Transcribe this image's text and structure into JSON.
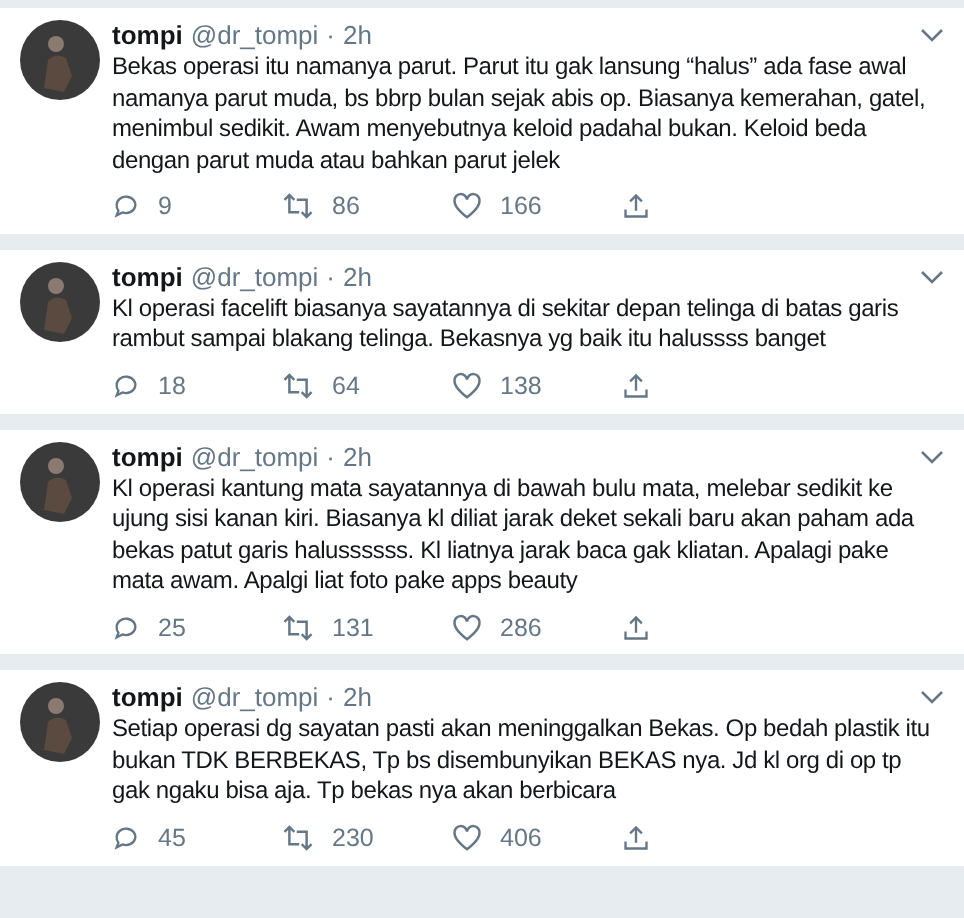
{
  "tweets": [
    {
      "name": "tompi",
      "handle": "@dr_tompi",
      "separator": "·",
      "time": "2h",
      "text": "Bekas operasi itu namanya parut. Parut itu gak lansung “halus” ada fase awal namanya parut muda, bs bbrp bulan sejak abis op. Biasanya kemerahan, gatel, menimbul sedikit. Awam menyebutnya keloid padahal bukan. Keloid beda dengan parut muda atau bahkan parut jelek",
      "replies": "9",
      "retweets": "86",
      "likes": "166"
    },
    {
      "name": "tompi",
      "handle": "@dr_tompi",
      "separator": "·",
      "time": "2h",
      "text": "Kl operasi facelift biasanya sayatannya di sekitar depan telinga di batas garis rambut sampai blakang telinga. Bekasnya yg baik itu halussss banget",
      "replies": "18",
      "retweets": "64",
      "likes": "138"
    },
    {
      "name": "tompi",
      "handle": "@dr_tompi",
      "separator": "·",
      "time": "2h",
      "text": "Kl operasi kantung mata sayatannya di bawah bulu mata, melebar sedikit ke ujung sisi kanan kiri. Biasanya kl diliat jarak deket sekali baru akan paham ada bekas patut garis halussssss. Kl liatnya jarak baca gak kliatan. Apalagi pake mata awam. Apalgi liat foto pake apps beauty",
      "replies": "25",
      "retweets": "131",
      "likes": "286"
    },
    {
      "name": "tompi",
      "handle": "@dr_tompi",
      "separator": "·",
      "time": "2h",
      "text": "Setiap operasi dg sayatan pasti akan meninggalkan Bekas. Op bedah plastik itu bukan TDK BERBEKAS, Tp bs disembunyikan BEKAS nya. Jd kl org di op tp gak ngaku bisa aja. Tp bekas nya akan berbicara",
      "replies": "45",
      "retweets": "230",
      "likes": "406"
    }
  ]
}
